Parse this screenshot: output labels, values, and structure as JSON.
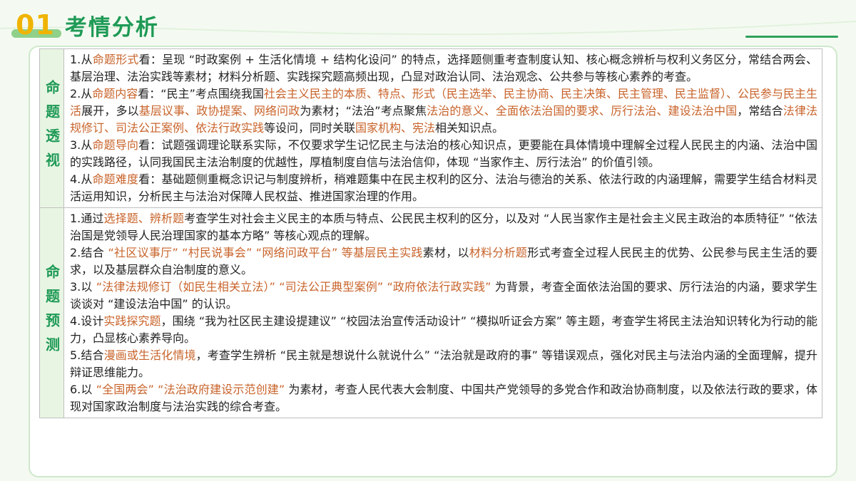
{
  "header": {
    "number": "01",
    "title": "考情分析"
  },
  "sections": [
    {
      "label": "命题透视",
      "items": [
        [
          {
            "t": "1.从"
          },
          {
            "t": "命题形式",
            "h": true
          },
          {
            "t": "看：呈现 “时政案例 + 生活化情境 + 结构化设问” 的特点，选择题侧重考查制度认知、核心概念辨析与权利义务区分，常结合两会、基层治理、法治实践等素材；材料分析题、实践探究题高频出现，凸显对政治认同、法治观念、公共参与等核心素养的考查。"
          }
        ],
        [
          {
            "t": "2.从"
          },
          {
            "t": "命题内容",
            "h": true
          },
          {
            "t": "看：“民主”考点围绕我国"
          },
          {
            "t": "社会主义民主的本质、特点、形式（民主选举、民主协商、民主决策、民主管理、民主监督）、公民参与民主生活",
            "h": true
          },
          {
            "t": "展开，多以"
          },
          {
            "t": "基层议事、政协提案、网络问政",
            "h": true
          },
          {
            "t": "为素材；“法治”考点聚焦"
          },
          {
            "t": "法治的意义、全面依法治国的要求、厉行法治、建设法治中国",
            "h": true
          },
          {
            "t": "，常结合"
          },
          {
            "t": "法律法规修订、司法公正案例、依法行政实践",
            "h": true
          },
          {
            "t": "等设问，同时关联"
          },
          {
            "t": "国家机构、宪法",
            "h": true
          },
          {
            "t": "相关知识点。"
          }
        ],
        [
          {
            "t": "3.从"
          },
          {
            "t": "命题导向",
            "h": true
          },
          {
            "t": "看：试题强调理论联系实际，不仅要求学生记忆民主与法治的核心知识点，更要能在具体情境中理解全过程人民民主的内涵、法治中国的实践路径，认同我国民主法治制度的优越性，厚植制度自信与法治信仰，体现 “当家作主、厉行法治” 的价值引领。"
          }
        ],
        [
          {
            "t": "4.从"
          },
          {
            "t": "命题难度",
            "h": true
          },
          {
            "t": "看：基础题侧重概念识记与制度辨析，稍难题集中在民主权利的区分、法治与德治的关系、依法行政的内涵理解，需要学生结合材料灵活运用知识，分析民主与法治对保障人民权益、推进国家治理的作用。"
          }
        ]
      ]
    },
    {
      "label": "命题预测",
      "items": [
        [
          {
            "t": "1.通过"
          },
          {
            "t": "选择题、辨析题",
            "h": true
          },
          {
            "t": "考查学生对社会主义民主的本质与特点、公民民主权利的区分，以及对 “人民当家作主是社会主义民主政治的本质特征” “依法治国是党领导人民治理国家的基本方略” 等核心观点的理解。"
          }
        ],
        [
          {
            "t": "2.结合 "
          },
          {
            "t": "“社区议事厅” “村民说事会” “网络问政平台” 等基层民主实践",
            "h": true
          },
          {
            "t": "素材，以"
          },
          {
            "t": "材料分析题",
            "h": true
          },
          {
            "t": "形式考查全过程人民民主的优势、公民参与民主生活的要求，以及基层群众自治制度的意义。"
          }
        ],
        [
          {
            "t": "3.以 "
          },
          {
            "t": "“法律法规修订（如民生相关立法）” “司法公正典型案例” “政府依法行政实践”",
            "h": true
          },
          {
            "t": " 为背景，考查全面依法治国的要求、厉行法治的内涵，要求学生谈谈对 “建设法治中国” 的认识。"
          }
        ],
        [
          {
            "t": "4.设计"
          },
          {
            "t": "实践探究题",
            "h": true
          },
          {
            "t": "，围绕 “我为社区民主建设提建议” “校园法治宣传活动设计” “模拟听证会方案” 等主题，考查学生将民主法治知识转化为行动的能力，凸显核心素养导向。"
          }
        ],
        [
          {
            "t": "5.结合"
          },
          {
            "t": "漫画或生活化情境",
            "h": true
          },
          {
            "t": "，考查学生辨析 “民主就是想说什么就说什么” “法治就是政府的事” 等错误观点，强化对民主与法治内涵的全面理解，提升辩证思维能力。"
          }
        ],
        [
          {
            "t": "6.以 "
          },
          {
            "t": "“全国两会” “法治政府建设示范创建”",
            "h": true
          },
          {
            "t": " 为素材，考查人民代表大会制度、中国共产党领导的多党合作和政治协商制度，以及依法行政的要求，体现对国家政治制度与法治实践的综合考查。"
          }
        ]
      ]
    }
  ],
  "colors": {
    "accent_green": "#1f9a56",
    "number_yellow": "#f0b400",
    "highlight": "#c8632a"
  }
}
